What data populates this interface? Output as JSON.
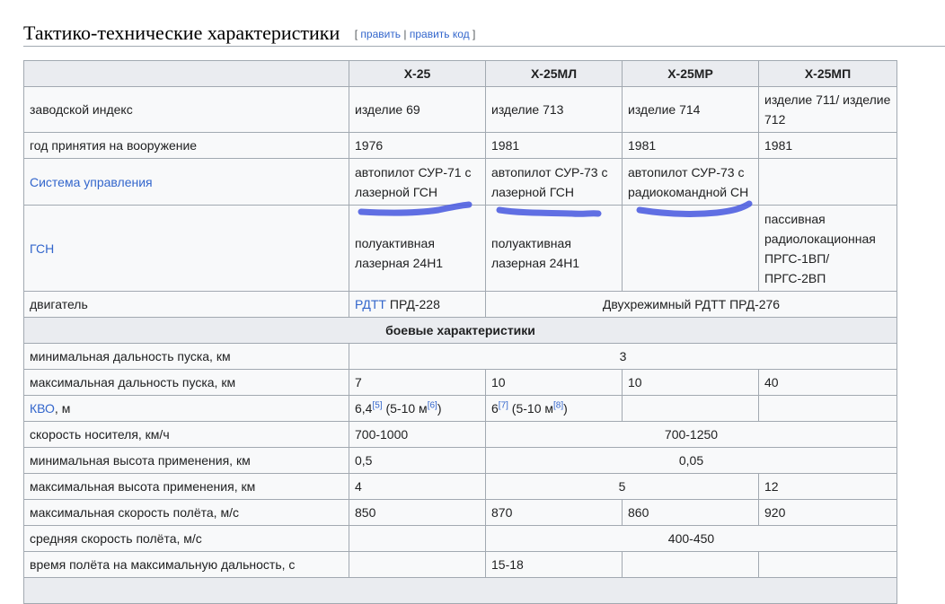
{
  "section": {
    "title": "Тактико-технические характеристики",
    "edit_open": "[",
    "edit": "править",
    "edit_sep": "|",
    "edit_code": "править код",
    "edit_close": "]"
  },
  "columns": [
    "Х-25",
    "Х-25МЛ",
    "Х-25МР",
    "Х-25МП"
  ],
  "rows": {
    "index": {
      "label": "заводской индекс",
      "v": [
        "изделие 69",
        "изделие 713",
        "изделие 714",
        "изделие 711/ изделие 712"
      ]
    },
    "year": {
      "label": "год принятия на вооружение",
      "v": [
        "1976",
        "1981",
        "1981",
        "1981"
      ]
    },
    "control": {
      "label": "Система управления",
      "v": [
        "автопилот СУР-71 с лазерной ГСН",
        "автопилот СУР-73 с лазерной ГСН",
        "автопилот СУР-73 с радиокомандной СН",
        ""
      ]
    },
    "seeker": {
      "label": "ГСН",
      "v": [
        "полуактивная лазерная 24Н1",
        "полуактивная лазерная 24Н1",
        "",
        "пассивная радиолокационная ПРГС-1ВП/ ПРГС-2ВП"
      ]
    },
    "engine": {
      "label": "двигатель",
      "link": "РДТТ",
      "v0": "ПРД-228",
      "v1": "Двухрежимный РДТТ ПРД-276"
    },
    "combat_header": "боевые характеристики",
    "min_range": {
      "label": "минимальная дальность пуска, км",
      "v": "3"
    },
    "max_range": {
      "label": "максимальная дальность пуска, км",
      "v": [
        "7",
        "10",
        "10",
        "40"
      ]
    },
    "cep": {
      "label": "КВО",
      "unit": ", м",
      "v0": "6,4",
      "v0_ref1": "[5]",
      "v0_mid": " (5-10 м",
      "v0_ref2": "[6]",
      "v0_end": ")",
      "v1": "6",
      "v1_ref1": "[7]",
      "v1_mid": " (5-10 м",
      "v1_ref2": "[8]",
      "v1_end": ")"
    },
    "carrier_speed": {
      "label": "скорость носителя, км/ч",
      "v0": "700-1000",
      "v1": "700-1250"
    },
    "min_alt": {
      "label": "минимальная высота применения, км",
      "v0": "0,5",
      "v1": "0,05"
    },
    "max_alt": {
      "label": "максимальная высота применения, км",
      "v0": "4",
      "v1": "5",
      "v2": "12"
    },
    "max_speed": {
      "label": "максимальная скорость полёта, м/с",
      "v": [
        "850",
        "870",
        "860",
        "920"
      ]
    },
    "avg_speed": {
      "label": "средняя скорость полёта, м/с",
      "v1": "400-450"
    },
    "flight_time": {
      "label": "время полёта на максимальную дальность, с",
      "v1": "15-18"
    }
  },
  "colors": {
    "link": "#3366cc",
    "header_bg": "#eaecf0",
    "cell_bg": "#f8f9fa",
    "border": "#a2a9b1",
    "scribble": "#4f5fe0"
  }
}
